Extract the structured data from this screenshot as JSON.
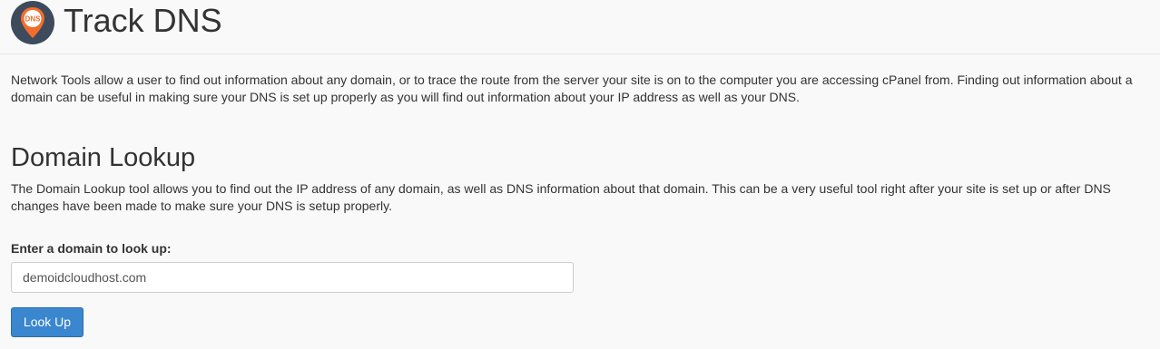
{
  "header": {
    "logo_icon": "dns-location-pin-icon",
    "logo_text": "DNS",
    "title": "Track DNS",
    "colors": {
      "logo_circle": "#3d4b5c",
      "logo_pin": "#f26d2d"
    }
  },
  "intro": {
    "text": "Network Tools allow a user to find out information about any domain, or to trace the route from the server your site is on to the computer you are accessing cPanel from. Finding out information about a domain can be useful in making sure your DNS is set up properly as you will find out information about your IP address as well as your DNS."
  },
  "domain_lookup": {
    "title": "Domain Lookup",
    "description": "The Domain Lookup tool allows you to find out the IP address of any domain, as well as DNS information about that domain. This can be a very useful tool right after your site is set up or after DNS changes have been made to make sure your DNS is setup properly.",
    "field_label": "Enter a domain to look up:",
    "field_value": "demoidcloudhost.com",
    "button_label": "Look Up",
    "button_color": "#3a87cf"
  }
}
